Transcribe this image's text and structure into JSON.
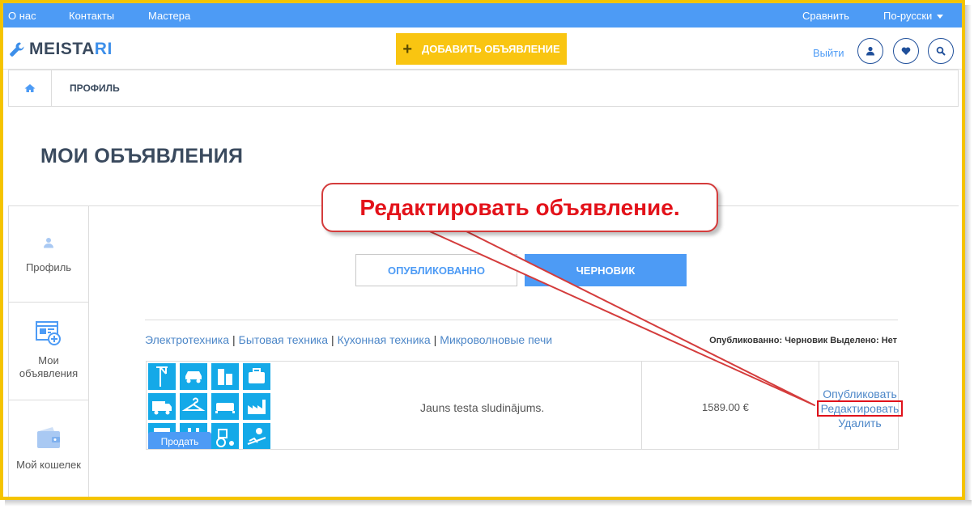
{
  "topbar": {
    "about": "О нас",
    "contacts": "Контакты",
    "masters": "Мастера",
    "compare": "Сравнить",
    "language": "По-русски"
  },
  "header": {
    "logo_main": "MEISTA",
    "logo_accent": "RI",
    "add_label": "ДОБАВИТЬ ОБЪЯВЛЕНИЕ",
    "add_icon": "+",
    "logout": "Выйти",
    "icons": [
      "user-icon",
      "heart-icon",
      "search-icon"
    ]
  },
  "breadcrumb": {
    "home_icon": "home-icon",
    "current": "ПРОФИЛЬ"
  },
  "page": {
    "title": "МОИ ОБЪЯВЛЕНИЯ"
  },
  "sidebar": {
    "items": [
      {
        "label": "Профиль",
        "icon": "user-icon"
      },
      {
        "label": "Мои объявления",
        "icon": "ads-icon"
      },
      {
        "label": "Мой кошелек",
        "icon": "wallet-icon"
      }
    ]
  },
  "tabs": {
    "published": "ОПУБЛИКОВАННО",
    "draft": "ЧЕРНОВИК"
  },
  "listing": {
    "categories": [
      "Электротехника",
      "Бытовая техника",
      "Кухонная техника",
      "Микроволновые печи"
    ],
    "status_text": "Опубликованно: Черновик Выделено: Нет",
    "badge": "Продать",
    "title": "Jauns testa sludinājums.",
    "price": "1589.00 €",
    "actions": {
      "publish": "Опубликовать",
      "edit": "Редактировать",
      "delete": "Удалить"
    }
  },
  "callout": {
    "text": "Редактировать объявление."
  },
  "colors": {
    "brand_blue": "#4d9bf5",
    "accent_yellow": "#f9c511",
    "frame_yellow": "#f5c400",
    "annotation_red": "#e3121a"
  }
}
